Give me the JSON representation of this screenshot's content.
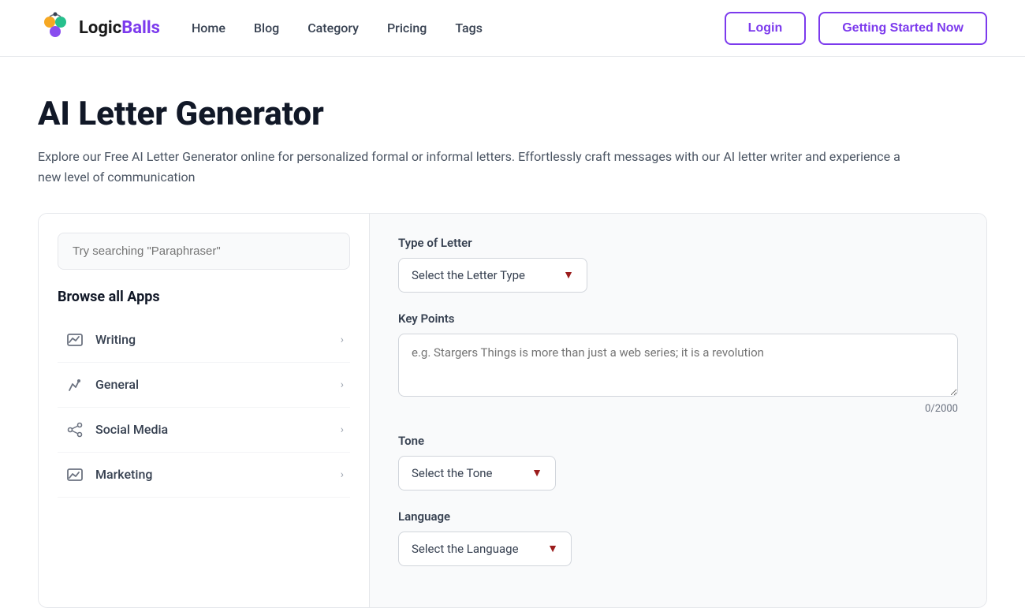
{
  "header": {
    "logo_text_logic": "Logic",
    "logo_text_balls": "Balls",
    "nav": {
      "home": "Home",
      "blog": "Blog",
      "category": "Category",
      "pricing": "Pricing",
      "tags": "Tags"
    },
    "login_label": "Login",
    "get_started_label": "Getting Started Now"
  },
  "page": {
    "title": "AI Letter Generator",
    "description": "Explore our Free AI Letter Generator online for personalized formal or informal letters. Effortlessly craft messages with our AI letter writer and experience a new level of communication"
  },
  "left_panel": {
    "search_placeholder": "Try searching \"Paraphraser\"",
    "browse_title": "Browse all Apps",
    "items": [
      {
        "label": "Writing",
        "icon": "chart-icon"
      },
      {
        "label": "General",
        "icon": "pen-icon"
      },
      {
        "label": "Social Media",
        "icon": "share-icon"
      },
      {
        "label": "Marketing",
        "icon": "chart2-icon"
      }
    ]
  },
  "right_panel": {
    "type_of_letter_label": "Type of Letter",
    "letter_type_placeholder": "Select the Letter Type",
    "key_points_label": "Key Points",
    "key_points_placeholder": "e.g. Stargers Things is more than just a web series; it is a revolution",
    "char_count": "0/2000",
    "tone_label": "Tone",
    "tone_placeholder": "Select the Tone",
    "language_label": "Language",
    "language_placeholder": "Select the Language"
  }
}
